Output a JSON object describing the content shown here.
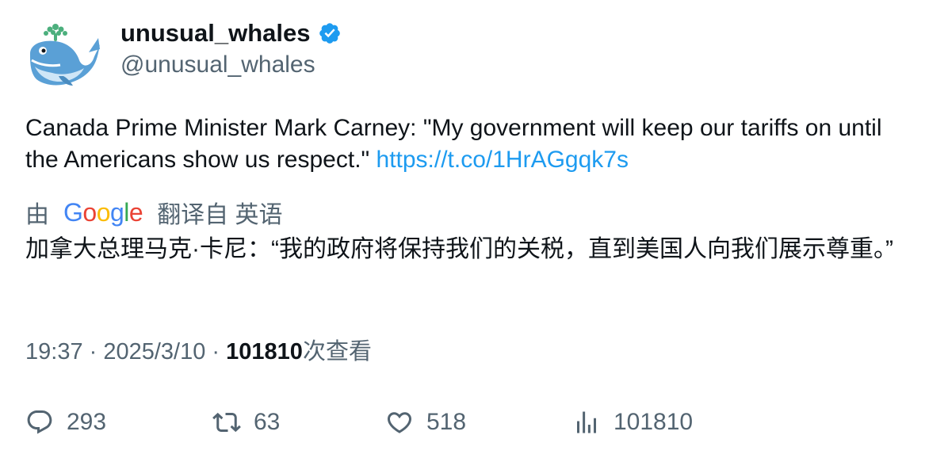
{
  "author": {
    "display_name": "unusual_whales",
    "handle": "@unusual_whales",
    "verified": true,
    "avatar_icon": "whale-avatar-icon"
  },
  "tweet": {
    "text": "Canada Prime Minister Mark Carney: \"My government will keep our tariffs on until the Americans show us respect.\" ",
    "link": "https://t.co/1HrAGgqk7s"
  },
  "translation": {
    "by_label": "由",
    "provider": "Google",
    "from_label": "翻译自 英语",
    "text": "加拿大总理马克·卡尼：“我的政府将保持我们的关税，直到美国人向我们展示尊重。”"
  },
  "meta": {
    "time": "19:37",
    "separator": " · ",
    "date": "2025/3/10",
    "views_count": "101810",
    "views_label": "次查看"
  },
  "actions": {
    "replies": "293",
    "retweets": "63",
    "likes": "518",
    "views": "101810"
  },
  "colors": {
    "text": "#0f1419",
    "secondary": "#536471",
    "link": "#1d9bf0",
    "verified": "#1d9bf0"
  }
}
